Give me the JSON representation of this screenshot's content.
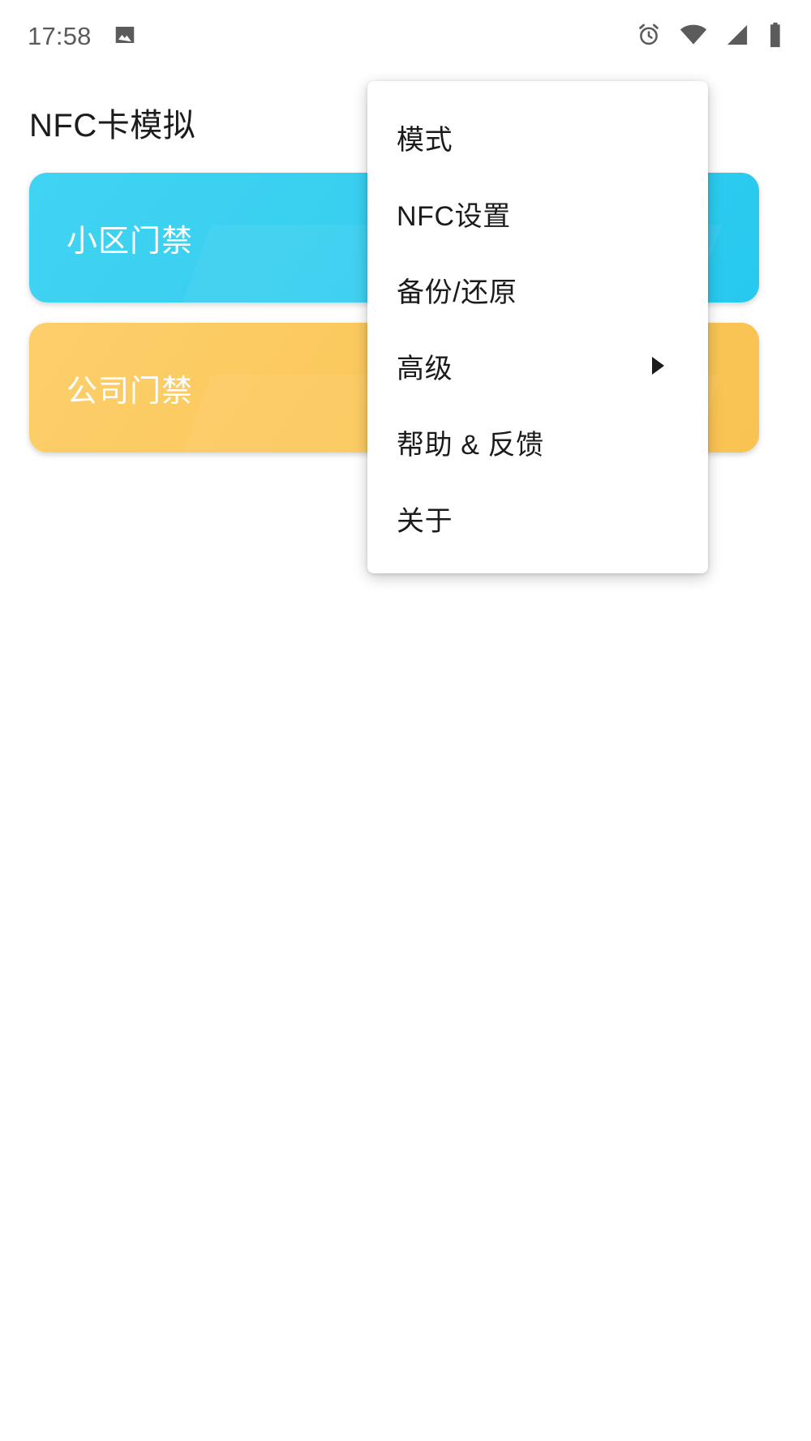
{
  "status_bar": {
    "clock": "17:58",
    "left_icons": [
      {
        "name": "image-icon",
        "glyph": "picture"
      }
    ],
    "right_icons": [
      {
        "name": "alarm-clock-icon",
        "glyph": "alarm"
      },
      {
        "name": "wifi-icon",
        "glyph": "wifi-full"
      },
      {
        "name": "cellular-signal-icon",
        "glyph": "signal-full"
      },
      {
        "name": "battery-icon",
        "glyph": "battery-full"
      }
    ],
    "icon_color": "#5b5b5b"
  },
  "app": {
    "title": "NFC卡模拟"
  },
  "cards": [
    {
      "label": "小区门禁",
      "color": "#38cff0",
      "variant": "blue"
    },
    {
      "label": "公司门禁",
      "color": "#fbc95d",
      "variant": "amber"
    }
  ],
  "overflow_menu": {
    "visible": true,
    "background": "#ffffff",
    "items": [
      {
        "label": "模式",
        "has_submenu": false
      },
      {
        "label": "NFC设置",
        "has_submenu": false
      },
      {
        "label": "备份/还原",
        "has_submenu": false
      },
      {
        "label": "高级",
        "has_submenu": true
      },
      {
        "label": "帮助 & 反馈",
        "has_submenu": false
      },
      {
        "label": "关于",
        "has_submenu": false
      }
    ]
  }
}
